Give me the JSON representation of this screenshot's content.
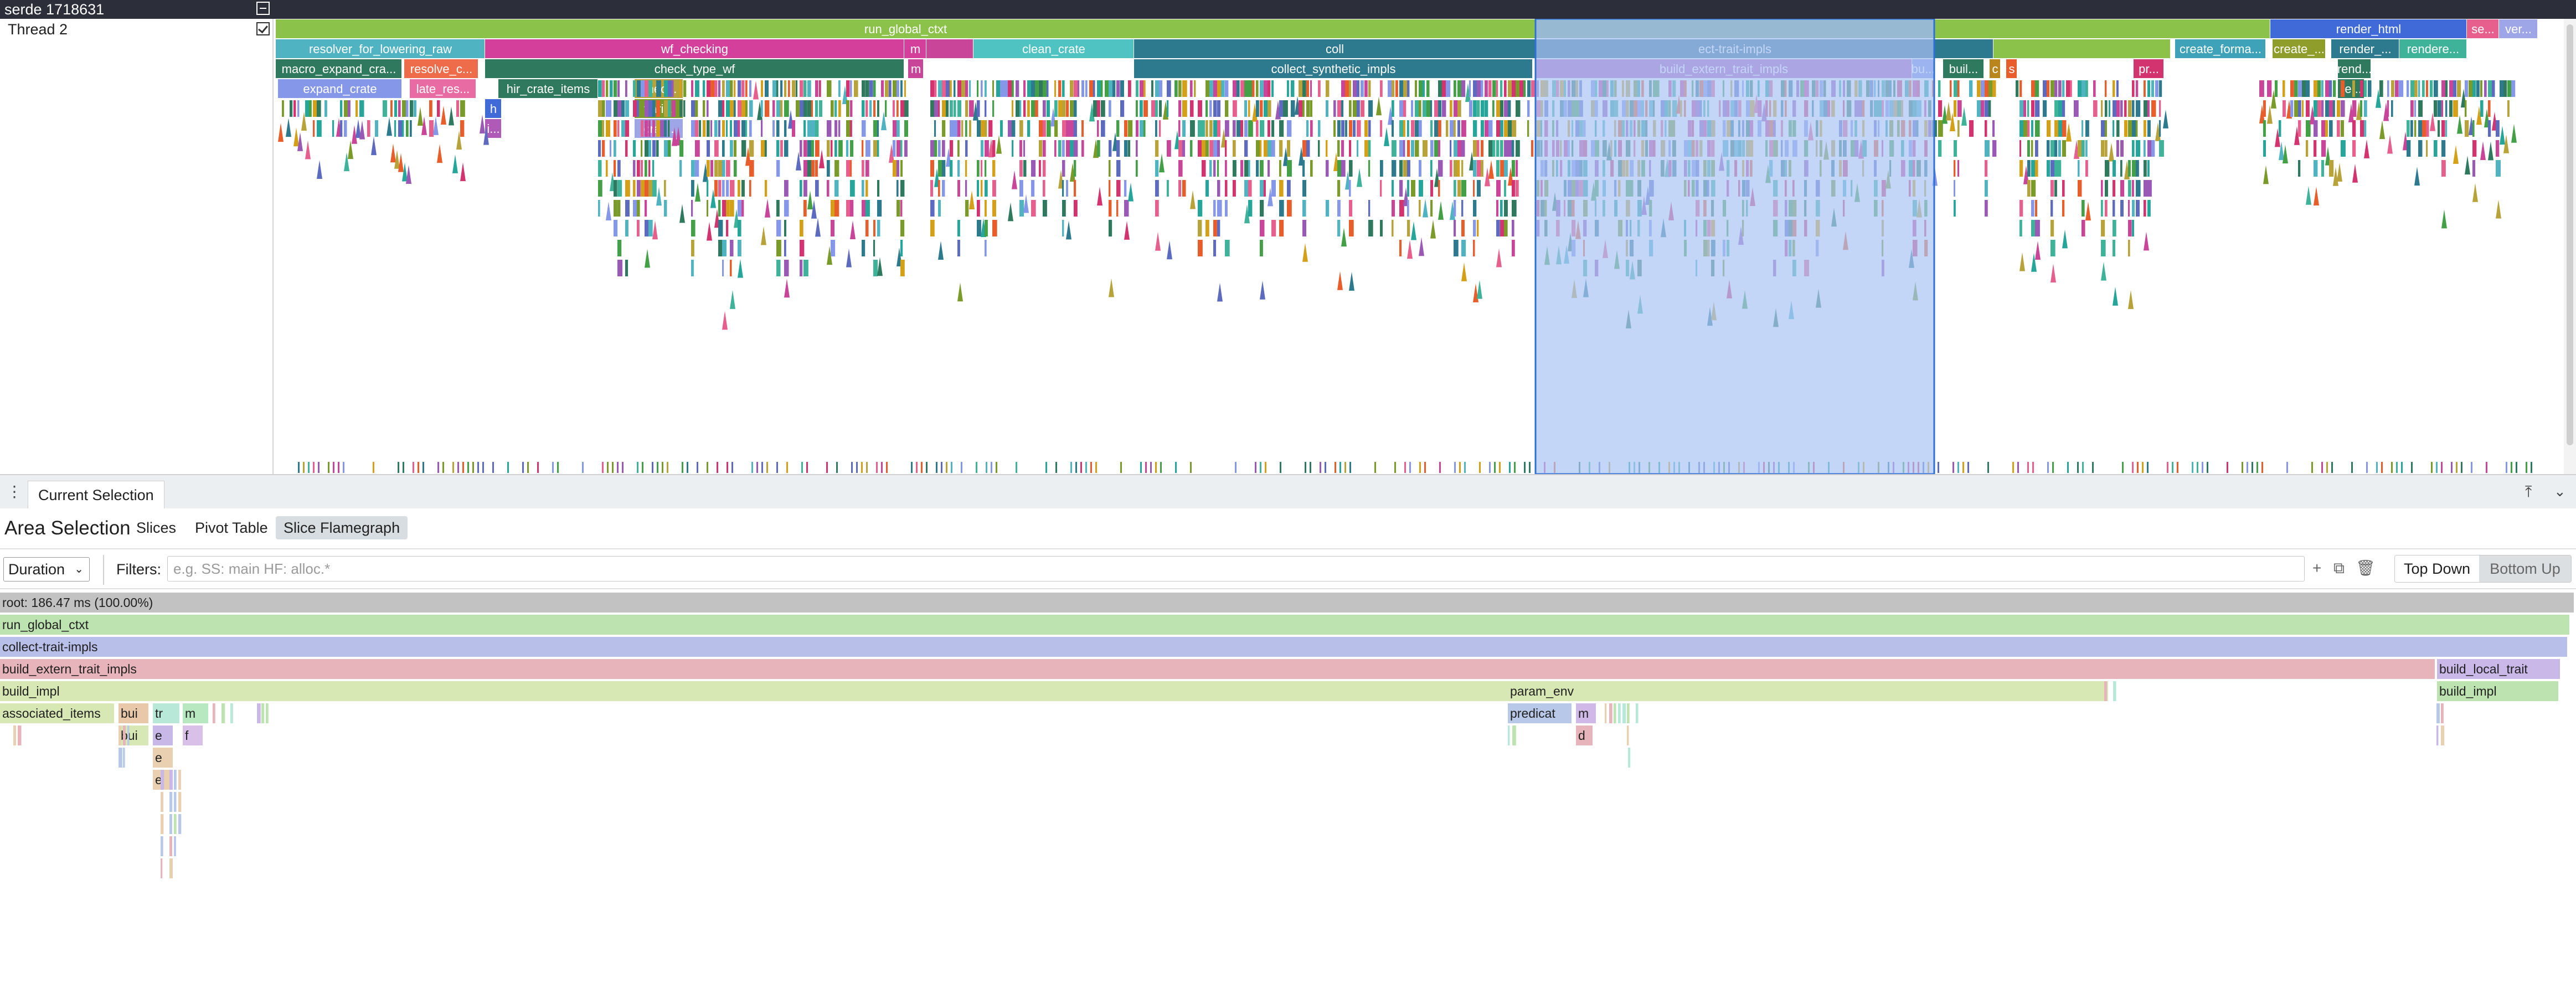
{
  "process": {
    "title": "serde 1718631"
  },
  "thread": {
    "name": "Thread 2"
  },
  "timeline_slices": [
    {
      "label": "run_global_ctxt"
    },
    {
      "label": "resolver_for_lowering_raw"
    },
    {
      "label": "wf_checking"
    },
    {
      "label": "m"
    },
    {
      "label": "clean_crate"
    },
    {
      "label": "coll"
    },
    {
      "label": "ect-trait-impls"
    },
    {
      "label": "render_html"
    },
    {
      "label": "se..."
    },
    {
      "label": "ver..."
    },
    {
      "label": "macro_expand_cra..."
    },
    {
      "label": "resolve_c..."
    },
    {
      "label": "check_type_wf"
    },
    {
      "label": "m"
    },
    {
      "label": "collect_synthetic_impls"
    },
    {
      "label": "build_extern_trait_impls"
    },
    {
      "label": "bu..."
    },
    {
      "label": "buil..."
    },
    {
      "label": "c"
    },
    {
      "label": "s"
    },
    {
      "label": "pr..."
    },
    {
      "label": "create_forma..."
    },
    {
      "label": "create_..."
    },
    {
      "label": "render_..."
    },
    {
      "label": "rendere..."
    },
    {
      "label": "expand_crate"
    },
    {
      "label": "late_res..."
    },
    {
      "label": "hir_crate_items"
    },
    {
      "label": "chec..."
    },
    {
      "label": "rend..."
    },
    {
      "label": "vari..."
    },
    {
      "label": "crat..."
    },
    {
      "label": "re..."
    },
    {
      "label": "h"
    },
    {
      "label": "i..."
    }
  ],
  "panel": {
    "tab_label": "Current Selection",
    "title": "Area Selection",
    "subtabs": [
      "Slices",
      "Pivot Table",
      "Slice Flamegraph"
    ],
    "metric": "Duration",
    "filters_label": "Filters:",
    "filter_placeholder": "e.g. SS: main HF: alloc.*",
    "toggle_top_down": "Top Down",
    "toggle_bottom_up": "Bottom Up"
  },
  "flamegraph_nodes": [
    {
      "label": "root: 186.47 ms (100.00%)"
    },
    {
      "label": "run_global_ctxt"
    },
    {
      "label": "collect-trait-impls"
    },
    {
      "label": "build_extern_trait_impls"
    },
    {
      "label": "build_local_trait"
    },
    {
      "label": "build_impl"
    },
    {
      "label": "param_env"
    },
    {
      "label": "build_impl"
    },
    {
      "label": "associated_items"
    },
    {
      "label": "bui"
    },
    {
      "label": "tr"
    },
    {
      "label": "m"
    },
    {
      "label": "predicat"
    },
    {
      "label": "m"
    },
    {
      "label": "bui"
    },
    {
      "label": "e"
    },
    {
      "label": "f"
    },
    {
      "label": "d"
    },
    {
      "label": "e"
    },
    {
      "label": "e"
    }
  ],
  "colors": {
    "header": "#2c2f3a",
    "selection_fill": "#a9c4f5",
    "selection_border": "#2f6fd6",
    "root_node": "#c2c2c2"
  }
}
